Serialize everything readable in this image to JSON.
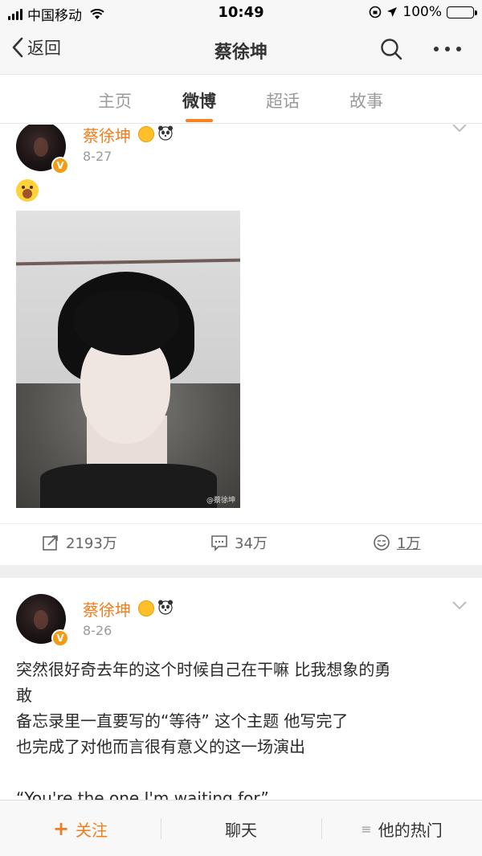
{
  "status_bar": {
    "carrier": "中国移动",
    "time": "10:49",
    "battery": "100%"
  },
  "nav": {
    "back_label": "返回",
    "title": "蔡徐坤"
  },
  "tabs": [
    {
      "label": "主页"
    },
    {
      "label": "微博"
    },
    {
      "label": "超话"
    },
    {
      "label": "故事"
    }
  ],
  "active_tab": "微博",
  "posts": [
    {
      "username": "蔡徐坤",
      "date": "8-27",
      "emoji": "shocked-face",
      "image_watermark": "@蔡徐坤",
      "reposts": "2193万",
      "comments": "34万",
      "likes": "1万"
    },
    {
      "username": "蔡徐坤",
      "date": "8-26",
      "text_lines": [
        "突然很好奇去年的这个时候自己在干嘛 比我想象的勇",
        "敢",
        "备忘录里一直要写的“等待” 这个主题 他写完了",
        "也完成了对他而言很有意义的这一场演出",
        "",
        "“You're the one I'm waiting for”"
      ]
    }
  ],
  "bottom_bar": {
    "follow": "关注",
    "chat": "聊天",
    "hot": "他的热门"
  },
  "colors": {
    "accent": "#f07d1d",
    "tab_indicator": "#f7821e",
    "verified_badge": "#f19b17"
  }
}
